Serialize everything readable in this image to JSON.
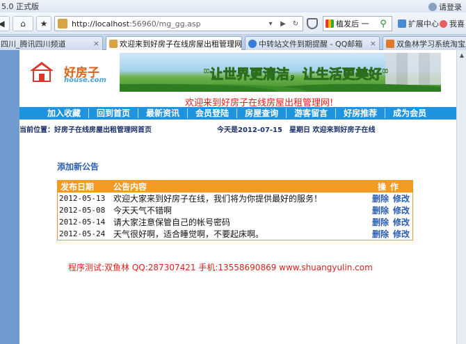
{
  "browser": {
    "title": "5.0 正式版",
    "login_text": "请登录",
    "back_label": "◀",
    "home_label": "⌂",
    "star_label": "★",
    "url_host": "http://localhost",
    "url_rest": ":56960/mg_gg.asp",
    "search_text": "植发后 一",
    "ext_label": "扩展中心",
    "fav_label": "我喜"
  },
  "tabs": [
    {
      "label": "四川_腾讯四川频道",
      "active": false,
      "color": "#d24b3c"
    },
    {
      "label": "欢迎来到好房子在线房屋出租管理网！",
      "active": true,
      "color": "#d9a441"
    },
    {
      "label": "中转站文件到期提醒 - QQ邮箱",
      "active": false,
      "color": "#3a7bd5"
    },
    {
      "label": "双鱼林学习系统淘宝店 -",
      "active": false,
      "color": "#e07a2a"
    }
  ],
  "site": {
    "brand_cn": "好房子",
    "brand_en": "house.com",
    "slogan": "\"让世界更清洁，让生活更美好\"",
    "welcome": "欢迎来到好房子在线房屋出租管理网!"
  },
  "nav": [
    "加入收藏",
    "回到首页",
    "最新资讯",
    "会员登陆",
    "房屋查询",
    "游客留言",
    "好房推荐",
    "成为会员"
  ],
  "location": {
    "current": "当前位置：好房子在线房屋出租管理网首页",
    "date_text": "今天是2012-07-15　星期日 欢迎来到好房子在线"
  },
  "notice": {
    "add_link": "添加新公告",
    "headers": {
      "date": "发布日期",
      "content": "公告内容",
      "operation": "操作"
    },
    "delete_label": "删除",
    "edit_label": "修改",
    "rows": [
      {
        "date": "2012-05-13",
        "content": "欢迎大家来到好房子在线，我们将为你提供最好的服务！"
      },
      {
        "date": "2012-05-08",
        "content": "今天天气不错啊"
      },
      {
        "date": "2012-05-14",
        "content": "请大家注意保管自己的帐号密码"
      },
      {
        "date": "2012-05-24",
        "content": "天气很好啊，适合睡觉啊，不要起床啊。"
      }
    ]
  },
  "footer": "程序测试:双鱼林 QQ:287307421 手机:13558690869 www.shuangyulin.com"
}
